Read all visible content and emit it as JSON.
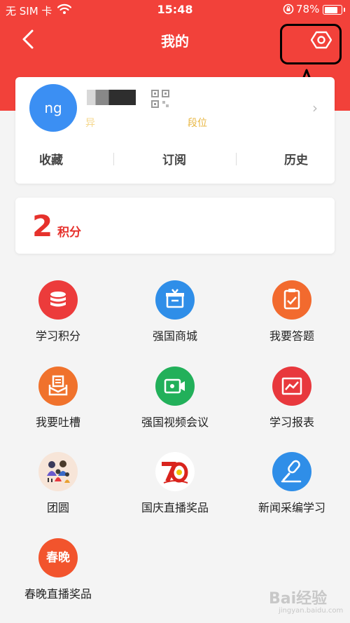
{
  "status_bar": {
    "carrier": "无 SIM 卡",
    "time": "15:48",
    "battery": "78%"
  },
  "header": {
    "title": "我的"
  },
  "profile": {
    "avatar_text": "ng",
    "level_prefix": "异",
    "level_suffix": "段位",
    "tabs": [
      "收藏",
      "订阅",
      "历史"
    ]
  },
  "points": {
    "value": "2",
    "label": "积分"
  },
  "grid": [
    {
      "label": "学习积分",
      "color": "#ec3b3b",
      "icon": "coin-stack-icon"
    },
    {
      "label": "强国商城",
      "color": "#2f8ee8",
      "icon": "gift-box-icon"
    },
    {
      "label": "我要答题",
      "color": "#f26a2e",
      "icon": "clipboard-check-icon"
    },
    {
      "label": "我要吐槽",
      "color": "#f0722c",
      "icon": "inbox-icon"
    },
    {
      "label": "强国视频会议",
      "color": "#22b05a",
      "icon": "video-camera-icon"
    },
    {
      "label": "学习报表",
      "color": "#e8383d",
      "icon": "chart-report-icon"
    },
    {
      "label": "团圆",
      "color": "#f7e5d8",
      "icon": "family-illustration-icon"
    },
    {
      "label": "国庆直播奖品",
      "color": "#ffffff",
      "icon": "anniversary-70-icon"
    },
    {
      "label": "新闻采编学习",
      "color": "#2f8ee8",
      "icon": "microphone-icon"
    },
    {
      "label": "春晚直播奖品",
      "color": "#f2542d",
      "icon_text": "春晚"
    }
  ],
  "watermark": {
    "text": "Bai经验",
    "sub": "jingyan.baidu.com"
  }
}
